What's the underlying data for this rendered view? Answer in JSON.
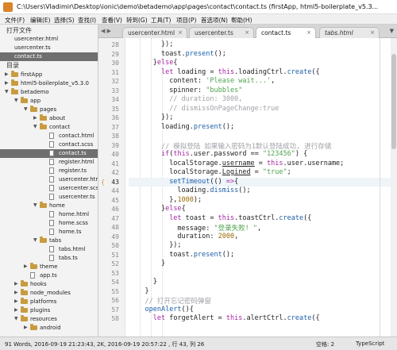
{
  "window": {
    "title": "C:\\Users\\Vladimir\\Desktop\\ionic\\demo\\betademo\\app\\pages\\contact\\contact.ts (firstApp, html5-boilerplate_v5.3..."
  },
  "menu": [
    "文件(F)",
    "编辑(E)",
    "选择(S)",
    "查找(I)",
    "查看(V)",
    "转到(G)",
    "工具(T)",
    "项目(P)",
    "首选项(N)",
    "帮助(H)"
  ],
  "sidebar": {
    "open_files_header": "打开文件",
    "folders_header": "目录",
    "open_files": [
      {
        "label": "usercenter.html",
        "selected": false
      },
      {
        "label": "usercenter.ts",
        "selected": false
      },
      {
        "label": "contact.ts",
        "selected": true
      }
    ],
    "tree": [
      {
        "label": "firstApp",
        "depth": 0,
        "kind": "folder",
        "arrow": "▶"
      },
      {
        "label": "html5-boilerplate_v5.3.0",
        "depth": 0,
        "kind": "folder",
        "arrow": "▶"
      },
      {
        "label": "betademo",
        "depth": 0,
        "kind": "folder",
        "arrow": "▼"
      },
      {
        "label": "app",
        "depth": 1,
        "kind": "folder",
        "arrow": "▼"
      },
      {
        "label": "pages",
        "depth": 2,
        "kind": "folder",
        "arrow": "▼"
      },
      {
        "label": "about",
        "depth": 3,
        "kind": "folder",
        "arrow": "▶"
      },
      {
        "label": "contact",
        "depth": 3,
        "kind": "folder",
        "arrow": "▼"
      },
      {
        "label": "contact.html",
        "depth": 4,
        "kind": "file",
        "arrow": ""
      },
      {
        "label": "contact.scss",
        "depth": 4,
        "kind": "file",
        "arrow": ""
      },
      {
        "label": "contact.ts",
        "depth": 4,
        "kind": "file",
        "arrow": "",
        "selected": true
      },
      {
        "label": "register.html",
        "depth": 4,
        "kind": "file",
        "arrow": ""
      },
      {
        "label": "register.ts",
        "depth": 4,
        "kind": "file",
        "arrow": ""
      },
      {
        "label": "usercenter.html",
        "depth": 4,
        "kind": "file",
        "arrow": ""
      },
      {
        "label": "usercenter.scss",
        "depth": 4,
        "kind": "file",
        "arrow": ""
      },
      {
        "label": "usercenter.ts",
        "depth": 4,
        "kind": "file",
        "arrow": ""
      },
      {
        "label": "home",
        "depth": 3,
        "kind": "folder",
        "arrow": "▼"
      },
      {
        "label": "home.html",
        "depth": 4,
        "kind": "file",
        "arrow": ""
      },
      {
        "label": "home.scss",
        "depth": 4,
        "kind": "file",
        "arrow": ""
      },
      {
        "label": "home.ts",
        "depth": 4,
        "kind": "file",
        "arrow": ""
      },
      {
        "label": "tabs",
        "depth": 3,
        "kind": "folder",
        "arrow": "▼"
      },
      {
        "label": "tabs.html",
        "depth": 4,
        "kind": "file",
        "arrow": ""
      },
      {
        "label": "tabs.ts",
        "depth": 4,
        "kind": "file",
        "arrow": ""
      },
      {
        "label": "theme",
        "depth": 2,
        "kind": "folder",
        "arrow": "▶"
      },
      {
        "label": "app.ts",
        "depth": 2,
        "kind": "file",
        "arrow": ""
      },
      {
        "label": "hooks",
        "depth": 1,
        "kind": "folder",
        "arrow": "▶"
      },
      {
        "label": "node_modules",
        "depth": 1,
        "kind": "folder",
        "arrow": "▶"
      },
      {
        "label": "platforms",
        "depth": 1,
        "kind": "folder",
        "arrow": "▶"
      },
      {
        "label": "plugins",
        "depth": 1,
        "kind": "folder",
        "arrow": "▶"
      },
      {
        "label": "resources",
        "depth": 1,
        "kind": "folder",
        "arrow": "▼"
      },
      {
        "label": "android",
        "depth": 2,
        "kind": "folder",
        "arrow": "▶"
      }
    ]
  },
  "tabs": {
    "nav_arrows": "◀ ▶",
    "items": [
      {
        "label": "usercenter.html",
        "active": false,
        "preview": false
      },
      {
        "label": "usercenter.ts",
        "active": false,
        "preview": false
      },
      {
        "label": "contact.ts",
        "active": true,
        "preview": false
      },
      {
        "label": "tabs.html",
        "active": false,
        "preview": true
      }
    ],
    "close_glyph": "×",
    "dropdown_glyph": "▼"
  },
  "editor": {
    "current_line": 43,
    "lines": [
      {
        "n": 28,
        "tokens": [
          [
            "        ",
            ""
          ],
          [
            "});",
            "tk-punc"
          ]
        ]
      },
      {
        "n": 29,
        "tokens": [
          [
            "        ",
            ""
          ],
          [
            "toast",
            ""
          ],
          [
            ".",
            ""
          ],
          [
            "present",
            "tk-fn"
          ],
          [
            "();",
            ""
          ]
        ]
      },
      {
        "n": 30,
        "tokens": [
          [
            "      ",
            ""
          ],
          [
            "}",
            ""
          ],
          [
            "else",
            "tk-kw"
          ],
          [
            "{",
            ""
          ]
        ]
      },
      {
        "n": 31,
        "tokens": [
          [
            "        ",
            ""
          ],
          [
            "let",
            "tk-kw"
          ],
          [
            " loading = ",
            ""
          ],
          [
            "this",
            "tk-this"
          ],
          [
            ".loadingCtrl.",
            ""
          ],
          [
            "create",
            "tk-fn"
          ],
          [
            "({",
            ""
          ]
        ]
      },
      {
        "n": 32,
        "tokens": [
          [
            "          ",
            ""
          ],
          [
            "content",
            ""
          ],
          [
            ": ",
            ""
          ],
          [
            "'Please wait...'",
            "tk-str"
          ],
          [
            ",",
            ""
          ]
        ]
      },
      {
        "n": 33,
        "tokens": [
          [
            "          ",
            ""
          ],
          [
            "spinner",
            ""
          ],
          [
            ": ",
            ""
          ],
          [
            "\"bubbles\"",
            "tk-str"
          ]
        ]
      },
      {
        "n": 34,
        "tokens": [
          [
            "          ",
            ""
          ],
          [
            "// duration: 3000,",
            "tk-cm"
          ]
        ]
      },
      {
        "n": 35,
        "tokens": [
          [
            "          ",
            ""
          ],
          [
            "// dismissOnPageChange:true",
            "tk-cm"
          ]
        ]
      },
      {
        "n": 36,
        "tokens": [
          [
            "        ",
            ""
          ],
          [
            "});",
            ""
          ]
        ]
      },
      {
        "n": 37,
        "tokens": [
          [
            "        ",
            ""
          ],
          [
            "loading",
            ""
          ],
          [
            ".",
            ""
          ],
          [
            "present",
            "tk-fn"
          ],
          [
            "();",
            ""
          ]
        ]
      },
      {
        "n": 38,
        "tokens": [
          [
            "",
            ""
          ]
        ]
      },
      {
        "n": 39,
        "tokens": [
          [
            "        ",
            ""
          ],
          [
            "// 模拟登陆 如果输入密码为1默认登陆成功, 进行存储",
            "tk-cm"
          ]
        ]
      },
      {
        "n": 40,
        "tokens": [
          [
            "        ",
            ""
          ],
          [
            "if",
            "tk-kw"
          ],
          [
            "(",
            ""
          ],
          [
            "this",
            "tk-this"
          ],
          [
            ".user.password == ",
            ""
          ],
          [
            "\"123456\"",
            "tk-str"
          ],
          [
            ") {",
            ""
          ]
        ]
      },
      {
        "n": 41,
        "tokens": [
          [
            "          ",
            ""
          ],
          [
            "localStorage",
            ""
          ],
          [
            ".",
            ""
          ],
          [
            "username",
            "tk-ul"
          ],
          [
            " = ",
            ""
          ],
          [
            "this",
            "tk-this"
          ],
          [
            ".user.username;",
            ""
          ]
        ]
      },
      {
        "n": 42,
        "tokens": [
          [
            "          ",
            ""
          ],
          [
            "localStorage",
            ""
          ],
          [
            ".",
            ""
          ],
          [
            "Logined",
            "tk-ul"
          ],
          [
            " = ",
            ""
          ],
          [
            "\"true\"",
            "tk-str"
          ],
          [
            ";",
            ""
          ]
        ]
      },
      {
        "n": 43,
        "tokens": [
          [
            "          ",
            ""
          ],
          [
            "setTimeout",
            "tk-fn"
          ],
          [
            "(() ",
            ""
          ],
          [
            "=>",
            "tk-kw"
          ],
          [
            "{",
            ""
          ]
        ]
      },
      {
        "n": 44,
        "tokens": [
          [
            "            ",
            ""
          ],
          [
            "loading",
            ""
          ],
          [
            ".",
            ""
          ],
          [
            "dismiss",
            "tk-fn"
          ],
          [
            "();",
            ""
          ]
        ]
      },
      {
        "n": 45,
        "tokens": [
          [
            "          ",
            ""
          ],
          [
            "},",
            ""
          ],
          [
            "1000",
            "tk-num"
          ],
          [
            ");",
            ""
          ]
        ]
      },
      {
        "n": 46,
        "tokens": [
          [
            "        ",
            ""
          ],
          [
            "}",
            ""
          ],
          [
            "else",
            "tk-kw"
          ],
          [
            "{",
            ""
          ]
        ]
      },
      {
        "n": 47,
        "tokens": [
          [
            "          ",
            ""
          ],
          [
            "let",
            "tk-kw"
          ],
          [
            " toast = ",
            ""
          ],
          [
            "this",
            "tk-this"
          ],
          [
            ".toastCtrl.",
            ""
          ],
          [
            "create",
            "tk-fn"
          ],
          [
            "({",
            ""
          ]
        ]
      },
      {
        "n": 48,
        "tokens": [
          [
            "            ",
            ""
          ],
          [
            "message",
            ""
          ],
          [
            ": ",
            ""
          ],
          [
            "\"登录失败! \"",
            "tk-str"
          ],
          [
            ",",
            ""
          ]
        ]
      },
      {
        "n": 49,
        "tokens": [
          [
            "            ",
            ""
          ],
          [
            "duration",
            ""
          ],
          [
            ": ",
            ""
          ],
          [
            "2000",
            "tk-num"
          ],
          [
            ",",
            ""
          ]
        ]
      },
      {
        "n": 50,
        "tokens": [
          [
            "          ",
            ""
          ],
          [
            "});",
            ""
          ]
        ]
      },
      {
        "n": 51,
        "tokens": [
          [
            "          ",
            ""
          ],
          [
            "toast",
            ""
          ],
          [
            ".",
            ""
          ],
          [
            "present",
            "tk-fn"
          ],
          [
            "();",
            ""
          ]
        ]
      },
      {
        "n": 52,
        "tokens": [
          [
            "        ",
            ""
          ],
          [
            "}",
            ""
          ]
        ]
      },
      {
        "n": 53,
        "tokens": [
          [
            "",
            ""
          ]
        ]
      },
      {
        "n": 54,
        "tokens": [
          [
            "      ",
            ""
          ],
          [
            "}",
            ""
          ]
        ]
      },
      {
        "n": 55,
        "tokens": [
          [
            "    ",
            ""
          ],
          [
            "}",
            ""
          ]
        ]
      },
      {
        "n": 56,
        "tokens": [
          [
            "    ",
            ""
          ],
          [
            "// 打开忘记密码弹窗",
            "tk-cm"
          ]
        ]
      },
      {
        "n": 57,
        "tokens": [
          [
            "    ",
            ""
          ],
          [
            "openAlert",
            "tk-fn"
          ],
          [
            "(){",
            ""
          ]
        ]
      },
      {
        "n": 58,
        "tokens": [
          [
            "      ",
            ""
          ],
          [
            "let",
            "tk-kw"
          ],
          [
            " forgetAlert = ",
            ""
          ],
          [
            "this",
            "tk-this"
          ],
          [
            ".alertCtrl.",
            ""
          ],
          [
            "create",
            "tk-fn"
          ],
          [
            "({",
            ""
          ]
        ]
      }
    ]
  },
  "status": {
    "left": "91 Words, 2016-09-19 21:23:43, 2K, 2016-09-19 20:57:22 , 行 43, 列 26",
    "indent": "空格: 2",
    "syntax": "TypeScript"
  }
}
